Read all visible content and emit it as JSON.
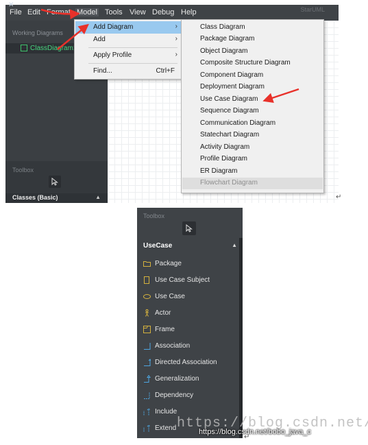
{
  "menubar": {
    "items": [
      "File",
      "Edit",
      "Format",
      "Model",
      "Tools",
      "View",
      "Debug",
      "Help"
    ],
    "active": "Model",
    "window_title": "StarUML"
  },
  "left_pane": {
    "working_diagrams_label": "Working Diagrams",
    "working_diagram_item": "ClassDiagram1",
    "toolbox_label": "Toolbox",
    "group_label": "Classes (Basic)"
  },
  "model_menu": {
    "items": [
      {
        "label": "Add Diagram",
        "submenu": true,
        "selected": true
      },
      {
        "label": "Add",
        "submenu": true
      },
      {
        "label": "Apply Profile",
        "submenu": true
      },
      {
        "label": "Find...",
        "shortcut": "Ctrl+F"
      }
    ]
  },
  "add_diagram_submenu": {
    "items": [
      "Class Diagram",
      "Package Diagram",
      "Object Diagram",
      "Composite Structure Diagram",
      "Component Diagram",
      "Deployment Diagram",
      "Use Case Diagram",
      "Sequence Diagram",
      "Communication Diagram",
      "Statechart Diagram",
      "Activity Diagram",
      "Profile Diagram",
      "ER Diagram",
      "Flowchart Diagram"
    ],
    "disabled_item": "Flowchart Diagram"
  },
  "toolbox_usecase": {
    "toolbox_label": "Toolbox",
    "group_label": "UseCase",
    "items": [
      {
        "label": "Package",
        "icon": "package-icon",
        "color": "#d4b13e"
      },
      {
        "label": "Use Case Subject",
        "icon": "subject-icon",
        "color": "#d4b13e"
      },
      {
        "label": "Use Case",
        "icon": "usecase-icon",
        "color": "#d4b13e"
      },
      {
        "label": "Actor",
        "icon": "actor-icon",
        "color": "#d4b13e"
      },
      {
        "label": "Frame",
        "icon": "frame-icon",
        "color": "#d4b13e"
      },
      {
        "label": "Association",
        "icon": "association-icon",
        "color": "#4ea6e0"
      },
      {
        "label": "Directed Association",
        "icon": "directed-association-icon",
        "color": "#4ea6e0"
      },
      {
        "label": "Generalization",
        "icon": "generalization-icon",
        "color": "#4ea6e0"
      },
      {
        "label": "Dependency",
        "icon": "dependency-icon",
        "color": "#4ea6e0"
      },
      {
        "label": "Include",
        "icon": "include-icon",
        "color": "#4ea6e0"
      },
      {
        "label": "Extend",
        "icon": "extend-icon",
        "color": "#4ea6e0"
      }
    ]
  },
  "watermark": {
    "big": "https://blog.csdn.net/l",
    "small": "https://blog.csdn.net/bobo_java_c"
  },
  "colors": {
    "menubar_bg": "#3f4347",
    "pane_bg": "#3b3f43",
    "menu_selected": "#99c9ef",
    "highlight_green": "#48d47e",
    "annotation_red": "#e8312a"
  }
}
